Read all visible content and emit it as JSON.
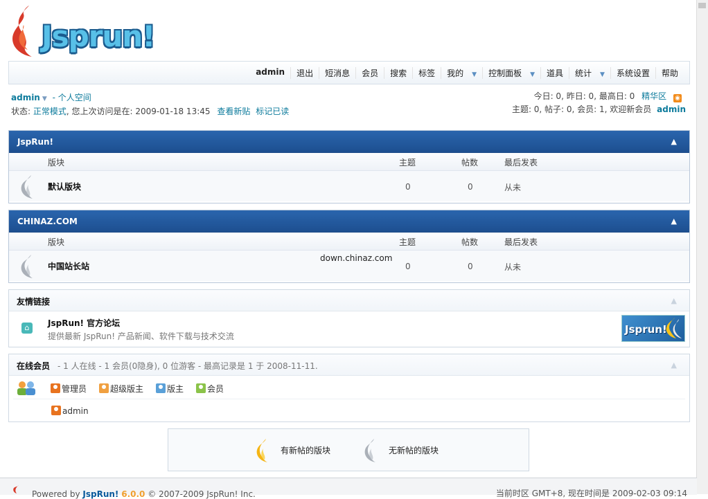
{
  "brand": {
    "logo_text": "Jsprun!"
  },
  "nav": {
    "items": [
      "admin",
      "退出",
      "短消息",
      "会员",
      "搜索",
      "标签",
      "我的",
      "控制面板",
      "道具",
      "统计",
      "系统设置",
      "帮助"
    ],
    "has_dropdown": [
      false,
      false,
      false,
      false,
      false,
      false,
      true,
      true,
      false,
      true,
      false,
      false
    ]
  },
  "user": {
    "name": "admin",
    "space_link": "- 个人空间",
    "status_label": "状态:",
    "status_mode": "正常模式",
    "last_visit": ", 您上次访问是在: 2009-01-18 13:45",
    "view_new": "查看新贴",
    "mark_read": "标记已读"
  },
  "stats": {
    "line1": "今日: 0, 昨日: 0, 最高日: 0",
    "digest": "精华区",
    "line2": "主题: 0, 帖子: 0, 会员: 1, 欢迎新会员",
    "newest_member": "admin"
  },
  "columns": {
    "forum": "版块",
    "topics": "主题",
    "posts": "帖数",
    "last_post": "最后发表"
  },
  "categories": [
    {
      "title": "JspRun!",
      "forums": [
        {
          "name": "默认版块",
          "topics": "0",
          "posts": "0",
          "last": "从未",
          "note": ""
        }
      ]
    },
    {
      "title": "CHINAZ.COM",
      "forums": [
        {
          "name": "中国站长站",
          "topics": "0",
          "posts": "0",
          "last": "从未",
          "note": "down.chinaz.com"
        }
      ]
    }
  ],
  "links": {
    "title": "友情链接",
    "items": [
      {
        "name": "JspRun! 官方论坛",
        "desc": "提供最新 JspRun! 产品新闻、软件下载与技术交流",
        "banner_text": "Jsprun!"
      }
    ]
  },
  "online": {
    "title": "在线会员",
    "summary": "- 1 人在线 - 1 会员(0隐身), 0 位游客 - 最高记录是 1 于 2008-11-11.",
    "roles": [
      "管理员",
      "超级版主",
      "版主",
      "会员"
    ],
    "role_colors": [
      "#e8731f",
      "#f0a040",
      "#5aa0d8",
      "#8bc34a"
    ],
    "users": [
      "admin"
    ]
  },
  "legend": {
    "new": "有新帖的版块",
    "none": "无新帖的版块"
  },
  "footer": {
    "powered_prefix": "Powered by",
    "product": "JspRun!",
    "version": "6.0.0",
    "copyright": "© 2007-2009 JspRun! Inc.",
    "timezone": "当前时区 GMT+8, 现在时间是 2009-02-03 09:14"
  }
}
